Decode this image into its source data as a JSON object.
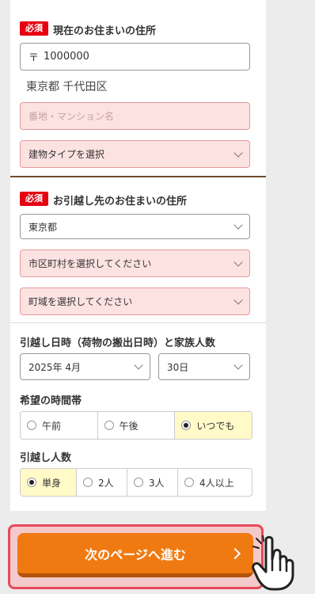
{
  "current_address": {
    "required_badge": "必須",
    "title": "現在のお住まいの住所",
    "postal_mark": "〒",
    "postal_code": "1000000",
    "resolved_address": "東京都 千代田区",
    "street_placeholder": "番地・マンション名",
    "building_type": "建物タイプを選択"
  },
  "new_address": {
    "required_badge": "必須",
    "title": "お引越し先のお住まいの住所",
    "prefecture": "東京都",
    "city": "市区町村を選択してください",
    "area": "町域を選択してください"
  },
  "schedule": {
    "title": "引越し日時（荷物の搬出日時）と家族人数",
    "month": "2025年 4月",
    "day": "30日"
  },
  "time_slot": {
    "title": "希望の時間帯",
    "options": [
      "午前",
      "午後",
      "いつでも"
    ],
    "selected": "いつでも"
  },
  "people": {
    "title": "引越し人数",
    "options": [
      "単身",
      "2人",
      "3人",
      "4人以上"
    ],
    "selected": "単身"
  },
  "next_button": {
    "label": "次のページへ進む"
  },
  "colors": {
    "accent": "#f07a12",
    "required": "#e60012",
    "invalid_field": "#fde2e2",
    "selected_option": "#fffac8"
  }
}
